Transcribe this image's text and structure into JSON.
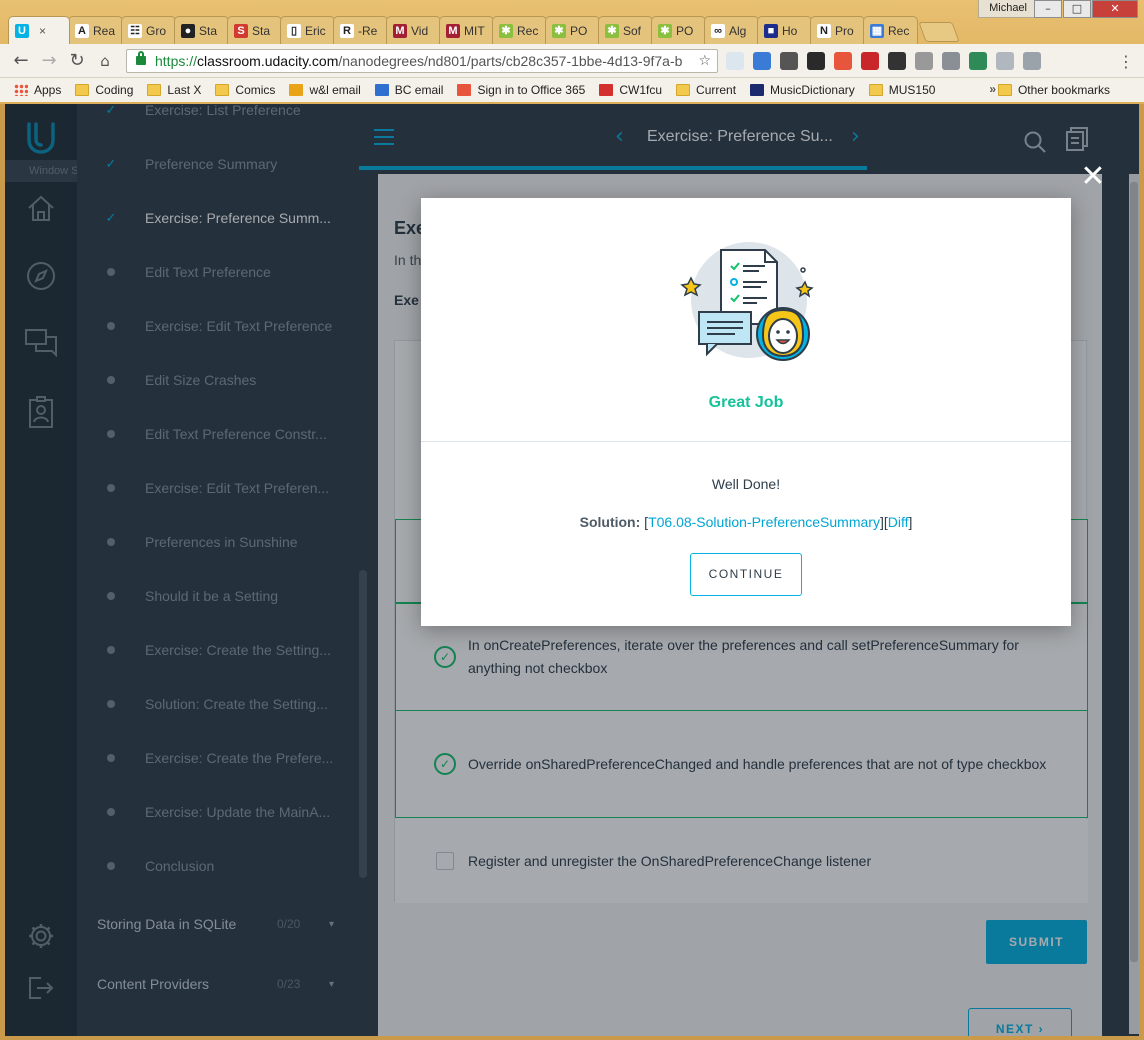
{
  "window": {
    "profile": "Michael",
    "minimize": "–",
    "maximize": "□",
    "close": "✕"
  },
  "tabs": [
    {
      "label": "",
      "favicon_color": "#02b3e4",
      "favicon_glyph": "U",
      "active": true
    },
    {
      "label": "Rea",
      "favicon_color": "#ffffff",
      "favicon_glyph": "A"
    },
    {
      "label": "Gro",
      "favicon_color": "#ffffff",
      "favicon_glyph": "☷"
    },
    {
      "label": "Sta",
      "favicon_color": "#222222",
      "favicon_glyph": "●"
    },
    {
      "label": "Sta",
      "favicon_color": "#d23a2f",
      "favicon_glyph": "S"
    },
    {
      "label": "Eric",
      "favicon_color": "#ffffff",
      "favicon_glyph": "▯"
    },
    {
      "label": "-Re",
      "favicon_color": "#ffffff",
      "favicon_glyph": "R"
    },
    {
      "label": "Vid",
      "favicon_color": "#a31f34",
      "favicon_glyph": "M"
    },
    {
      "label": "MIT",
      "favicon_color": "#a31f34",
      "favicon_glyph": "M"
    },
    {
      "label": "Rec",
      "favicon_color": "#8bbf3f",
      "favicon_glyph": "✱"
    },
    {
      "label": "PO",
      "favicon_color": "#8bbf3f",
      "favicon_glyph": "✱"
    },
    {
      "label": "Sof",
      "favicon_color": "#8bbf3f",
      "favicon_glyph": "✱"
    },
    {
      "label": "PO",
      "favicon_color": "#8bbf3f",
      "favicon_glyph": "✱"
    },
    {
      "label": "Alg",
      "favicon_color": "#ffffff",
      "favicon_glyph": "∞"
    },
    {
      "label": "Ho",
      "favicon_color": "#1d2d8c",
      "favicon_glyph": "■"
    },
    {
      "label": "Pro",
      "favicon_color": "#ffffff",
      "favicon_glyph": "N"
    },
    {
      "label": "Rec",
      "favicon_color": "#3a7bd5",
      "favicon_glyph": "▦"
    }
  ],
  "toolbar": {
    "back": "←",
    "forward": "→",
    "reload": "↻",
    "url_scheme": "https://",
    "url_host": "classroom.udacity.com",
    "url_path": "/nanodegrees/nd801/parts/cb28c357-1bbe-4d13-9f7a-b",
    "star": "☆",
    "menu": "⋮",
    "extension_colors": [
      "#dce6ef",
      "#3a7bd5",
      "#555555",
      "#2a2a2a",
      "#e8553d",
      "#c8262b",
      "#333333",
      "#999999",
      "#8a8f95",
      "#2e8b57",
      "#b0b7bf",
      "#9aa2aa"
    ]
  },
  "bookmarks": {
    "items": [
      {
        "label": "Apps",
        "type": "apps"
      },
      {
        "label": "Coding",
        "type": "folder"
      },
      {
        "label": "Last X",
        "type": "folder"
      },
      {
        "label": "Comics",
        "type": "folder"
      },
      {
        "label": "w&l email",
        "type": "site",
        "color": "#e8a317"
      },
      {
        "label": "BC email",
        "type": "site",
        "color": "#2f6fd0"
      },
      {
        "label": "Sign in to Office 365",
        "type": "site",
        "color": "#e8553d"
      },
      {
        "label": "CW1fcu",
        "type": "site",
        "color": "#d32f2f"
      },
      {
        "label": "Current",
        "type": "folder"
      },
      {
        "label": "MusicDictionary",
        "type": "site",
        "color": "#1a2a6c"
      },
      {
        "label": "MUS150",
        "type": "folder"
      }
    ],
    "more": "»",
    "other": "Other bookmarks"
  },
  "snip_label": "Window Snip",
  "topbar": {
    "title": "Exercise: Preference Su...",
    "prev": "‹",
    "next": "›"
  },
  "sidebar": {
    "lessons": [
      {
        "label": "Exercise: List Preference",
        "state": "done"
      },
      {
        "label": "Preference Summary",
        "state": "done"
      },
      {
        "label": "Exercise: Preference Summ...",
        "state": "current"
      },
      {
        "label": "Edit Text Preference",
        "state": "todo"
      },
      {
        "label": "Exercise: Edit Text Preference",
        "state": "todo"
      },
      {
        "label": "Edit Size Crashes",
        "state": "todo"
      },
      {
        "label": "Edit Text Preference Constr...",
        "state": "todo"
      },
      {
        "label": "Exercise: Edit Text Preferen...",
        "state": "todo"
      },
      {
        "label": "Preferences in Sunshine",
        "state": "todo"
      },
      {
        "label": "Should it be a Setting",
        "state": "todo"
      },
      {
        "label": "Exercise: Create the Setting...",
        "state": "todo"
      },
      {
        "label": "Solution: Create the Setting...",
        "state": "todo"
      },
      {
        "label": "Exercise: Create the Prefere...",
        "state": "todo"
      },
      {
        "label": "Exercise: Update the MainA...",
        "state": "todo"
      },
      {
        "label": "Conclusion",
        "state": "todo"
      }
    ],
    "sections": [
      {
        "label": "Storing Data in SQLite",
        "count": "0/20"
      },
      {
        "label": "Content Providers",
        "count": "0/23"
      }
    ]
  },
  "main": {
    "title": "Exe",
    "intro": "In th",
    "subtitle": "Exe",
    "options": [
      {
        "text": "In onCreatePreferences, iterate over the preferences and call setPreferenceSummary for anything not checkbox",
        "checked": true
      },
      {
        "text": "Override onSharedPreferenceChanged and handle preferences that are not of type checkbox",
        "checked": true
      },
      {
        "text": "Register and unregister the OnSharedPreferenceChange listener",
        "checked": false
      }
    ],
    "submit": "SUBMIT",
    "next": "NEXT"
  },
  "modal": {
    "close": "✕",
    "heading": "Great Job",
    "message": "Well Done!",
    "solution_label": "Solution:",
    "solution_link": "T06.08-Solution-PreferenceSummary",
    "diff_link": "Diff",
    "continue": "CONTINUE"
  },
  "colors": {
    "accent": "#02b3e4",
    "success": "#15c26b",
    "heading_green": "#15c29a",
    "nav_bg": "#2e3d49"
  }
}
